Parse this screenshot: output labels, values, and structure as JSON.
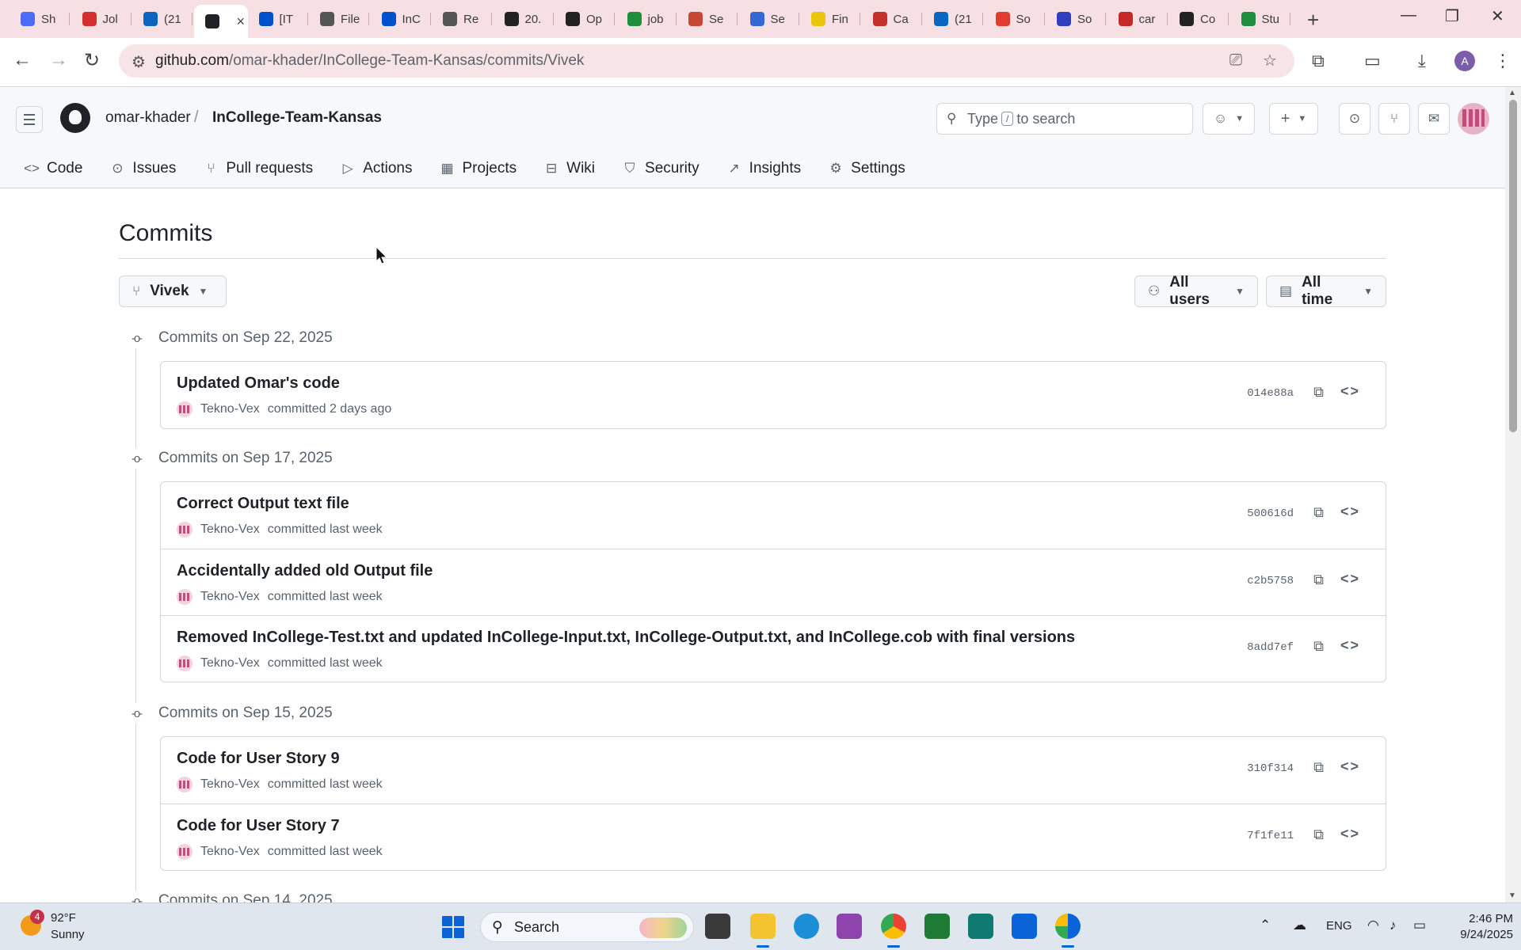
{
  "browser": {
    "tabs": [
      {
        "label": "Sh",
        "icon": "shortcut-icon",
        "color": "#4a6cf7"
      },
      {
        "label": "Jol",
        "icon": "handshake-icon",
        "color": "#d32f2f"
      },
      {
        "label": "(21",
        "icon": "linkedin-icon",
        "color": "#0a66c2"
      },
      {
        "label": "",
        "icon": "github-icon",
        "color": "#1f2328",
        "active": true
      },
      {
        "label": "[IT",
        "icon": "jira-icon",
        "color": "#0052cc"
      },
      {
        "label": "File",
        "icon": "gear-icon",
        "color": "#555555"
      },
      {
        "label": "InC",
        "icon": "jira-icon",
        "color": "#0052cc"
      },
      {
        "label": "Re",
        "icon": "gear-icon",
        "color": "#555555"
      },
      {
        "label": "20.",
        "icon": "gs-icon",
        "color": "#222222"
      },
      {
        "label": "Op",
        "icon": "gs-icon",
        "color": "#222222"
      },
      {
        "label": "job",
        "icon": "plus-square-icon",
        "color": "#1e8e3e"
      },
      {
        "label": "Se",
        "icon": "oracle-icon",
        "color": "#c74634"
      },
      {
        "label": "Se",
        "icon": "globe-icon",
        "color": "#3367d6"
      },
      {
        "label": "Fin",
        "icon": "asterisk-icon",
        "color": "#e9c60b"
      },
      {
        "label": "Ca",
        "icon": "c-logo-icon",
        "color": "#c4312b"
      },
      {
        "label": "(21",
        "icon": "linkedin-icon",
        "color": "#0a66c2"
      },
      {
        "label": "So",
        "icon": "triangle-icon",
        "color": "#e03e2d"
      },
      {
        "label": "So",
        "icon": "a-logo-icon",
        "color": "#2d3fbf"
      },
      {
        "label": "car",
        "icon": "canvas-icon",
        "color": "#c62828"
      },
      {
        "label": "Co",
        "icon": "openai-icon",
        "color": "#222222"
      },
      {
        "label": "Stu",
        "icon": "leaf-icon",
        "color": "#1e8e3e"
      }
    ],
    "url_host": "github.com",
    "url_path": "/omar-khader/InCollege-Team-Kansas/commits/Vivek",
    "profile_initial": "A"
  },
  "github": {
    "owner": "omar-khader",
    "slash": "/",
    "repo": "InCollege-Team-Kansas",
    "search_prefix": "Type",
    "search_key": "/",
    "search_suffix": "to search",
    "nav": [
      {
        "label": "Code",
        "icon": "code-icon",
        "glyph": "<>"
      },
      {
        "label": "Issues",
        "icon": "issue-icon",
        "glyph": "⊙"
      },
      {
        "label": "Pull requests",
        "icon": "pull-request-icon",
        "glyph": "⑂"
      },
      {
        "label": "Actions",
        "icon": "play-icon",
        "glyph": "▷"
      },
      {
        "label": "Projects",
        "icon": "table-icon",
        "glyph": "▦"
      },
      {
        "label": "Wiki",
        "icon": "book-icon",
        "glyph": "⊟"
      },
      {
        "label": "Security",
        "icon": "shield-icon",
        "glyph": "⛉"
      },
      {
        "label": "Insights",
        "icon": "graph-icon",
        "glyph": "↗"
      },
      {
        "label": "Settings",
        "icon": "gear-icon",
        "glyph": "⚙"
      }
    ]
  },
  "commits_page": {
    "title": "Commits",
    "branch": "Vivek",
    "users_filter": "All users",
    "time_filter": "All time",
    "groups": [
      {
        "heading": "Commits on Sep 22, 2025",
        "commits": [
          {
            "message": "Updated Omar's code",
            "author": "Tekno-Vex",
            "when": "committed 2 days ago",
            "sha": "014e88a"
          }
        ]
      },
      {
        "heading": "Commits on Sep 17, 2025",
        "commits": [
          {
            "message": "Correct Output text file",
            "author": "Tekno-Vex",
            "when": "committed last week",
            "sha": "500616d"
          },
          {
            "message": "Accidentally added old Output file",
            "author": "Tekno-Vex",
            "when": "committed last week",
            "sha": "c2b5758"
          },
          {
            "message": "Removed InCollege-Test.txt and updated InCollege-Input.txt, InCollege-Output.txt, and InCollege.cob with final versions",
            "author": "Tekno-Vex",
            "when": "committed last week",
            "sha": "8add7ef"
          }
        ]
      },
      {
        "heading": "Commits on Sep 15, 2025",
        "commits": [
          {
            "message": "Code for User Story 9",
            "author": "Tekno-Vex",
            "when": "committed last week",
            "sha": "310f314"
          },
          {
            "message": "Code for User Story 7",
            "author": "Tekno-Vex",
            "when": "committed last week",
            "sha": "7f1fe11"
          }
        ]
      },
      {
        "heading": "Commits on Sep 14, 2025",
        "commits": []
      }
    ]
  },
  "taskbar": {
    "weather_badge": "4",
    "temperature": "92°F",
    "condition": "Sunny",
    "search_label": "Search",
    "language": "ENG",
    "time": "2:46 PM",
    "date": "9/24/2025"
  },
  "colors": {
    "tabstrip": "#f7e0e3",
    "accent": "#0a64d8"
  }
}
